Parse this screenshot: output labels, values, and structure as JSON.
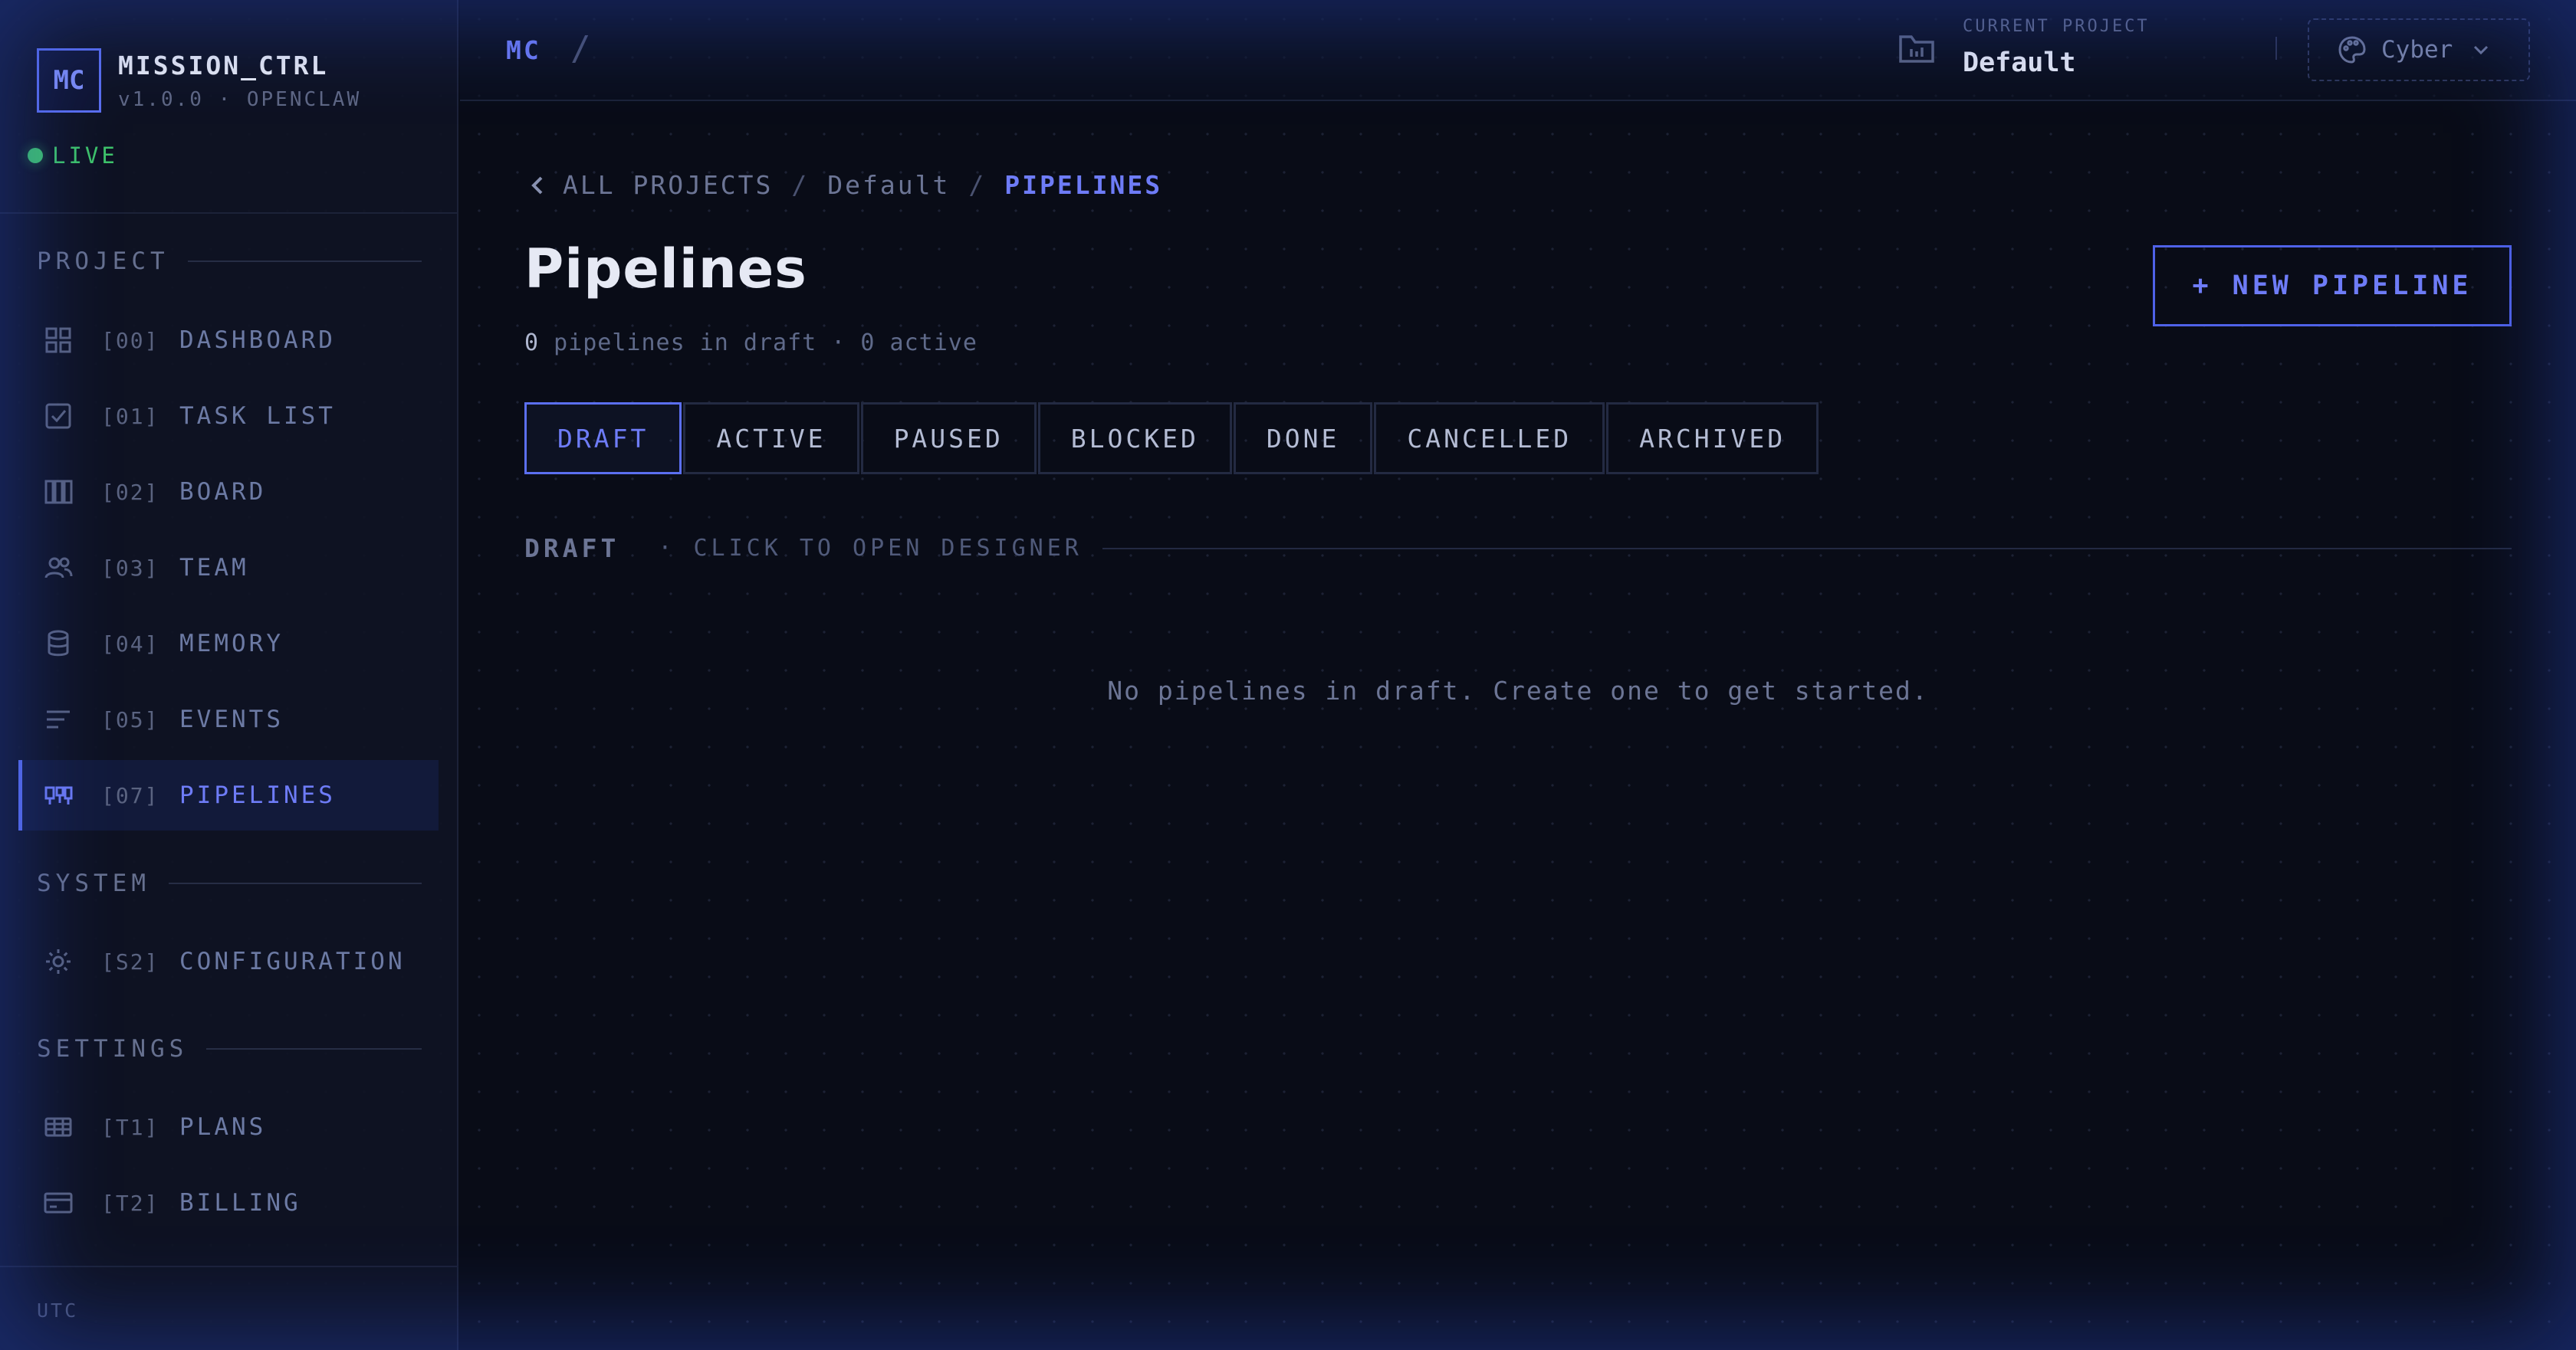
{
  "brand": {
    "logo": "MC",
    "name": "MISSION_CTRL",
    "version": "v1.0.0 · OPENCLAW",
    "status": "LIVE"
  },
  "sidebar": {
    "sections": [
      {
        "title": "PROJECT"
      },
      {
        "title": "SYSTEM"
      },
      {
        "title": "SETTINGS"
      }
    ],
    "items": [
      {
        "code": "[00]",
        "label": "DASHBOARD",
        "icon": "grid-icon"
      },
      {
        "code": "[01]",
        "label": "TASK LIST",
        "icon": "checkbox-icon"
      },
      {
        "code": "[02]",
        "label": "BOARD",
        "icon": "columns-icon"
      },
      {
        "code": "[03]",
        "label": "TEAM",
        "icon": "users-icon"
      },
      {
        "code": "[04]",
        "label": "MEMORY",
        "icon": "database-icon"
      },
      {
        "code": "[05]",
        "label": "EVENTS",
        "icon": "list-icon"
      },
      {
        "code": "[07]",
        "label": "PIPELINES",
        "icon": "pipeline-icon",
        "active": true
      },
      {
        "code": "[S2]",
        "label": "CONFIGURATION",
        "icon": "gear-icon"
      },
      {
        "code": "[T1]",
        "label": "PLANS",
        "icon": "table-icon"
      },
      {
        "code": "[T2]",
        "label": "BILLING",
        "icon": "card-icon"
      }
    ],
    "timezone": "UTC"
  },
  "header": {
    "root": "MC",
    "separator": "/",
    "project_caption": "CURRENT PROJECT",
    "project_name": "Default",
    "theme_label": "Cyber"
  },
  "breadcrumb": {
    "all": "ALL PROJECTS",
    "sep": "/",
    "project": "Default",
    "current": "PIPELINES"
  },
  "page": {
    "title": "Pipelines",
    "draft_count": "0",
    "draft_text": "pipelines in draft",
    "dot": "·",
    "active_count": "0",
    "active_text": "active",
    "new_button": "+ NEW PIPELINE"
  },
  "tabs": [
    "DRAFT",
    "ACTIVE",
    "PAUSED",
    "BLOCKED",
    "DONE",
    "CANCELLED",
    "ARCHIVED"
  ],
  "group": {
    "title": "DRAFT",
    "hint": "· CLICK TO OPEN DESIGNER"
  },
  "empty_message": "No pipelines in draft. Create one to get started.",
  "colors": {
    "accent": "#5b6ff0",
    "live": "#3ec46a",
    "background": "#090c17"
  }
}
